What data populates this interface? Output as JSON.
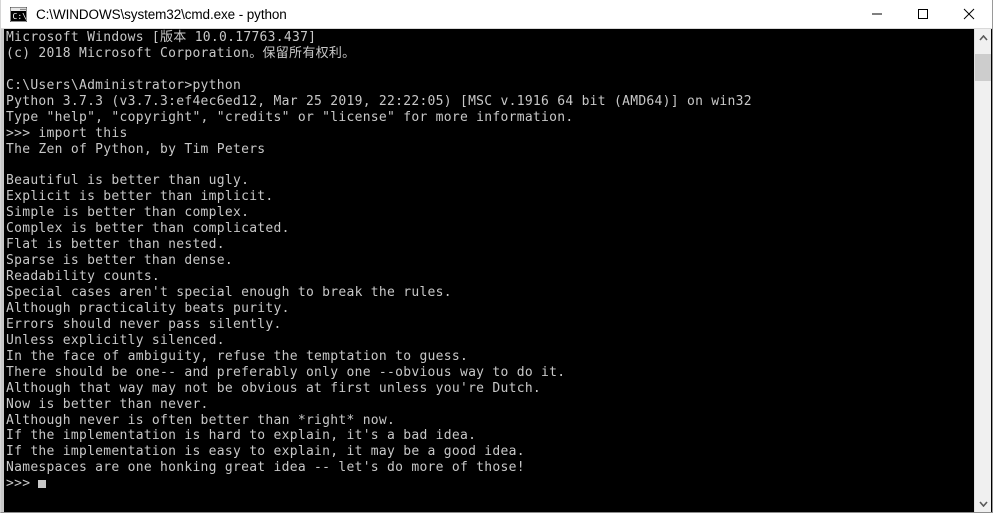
{
  "window": {
    "title": "C:\\WINDOWS\\system32\\cmd.exe - python",
    "icon": "cmd-console-icon",
    "background_color": "#000000",
    "titlebar_color": "#ffffff",
    "text_color": "#c8c8c8"
  },
  "controls": {
    "minimize_label": "Minimize",
    "maximize_label": "Maximize",
    "close_label": "Close"
  },
  "scrollbar": {
    "up_arrow_label": "Scroll up",
    "down_arrow_label": "Scroll down",
    "thumb_label": "Scroll thumb"
  },
  "console": {
    "lines": [
      "Microsoft Windows [版本 10.0.17763.437]",
      "(c) 2018 Microsoft Corporation。保留所有权利。",
      "",
      "C:\\Users\\Administrator>python",
      "Python 3.7.3 (v3.7.3:ef4ec6ed12, Mar 25 2019, 22:22:05) [MSC v.1916 64 bit (AMD64)] on win32",
      "Type \"help\", \"copyright\", \"credits\" or \"license\" for more information.",
      ">>> import this",
      "The Zen of Python, by Tim Peters",
      "",
      "Beautiful is better than ugly.",
      "Explicit is better than implicit.",
      "Simple is better than complex.",
      "Complex is better than complicated.",
      "Flat is better than nested.",
      "Sparse is better than dense.",
      "Readability counts.",
      "Special cases aren't special enough to break the rules.",
      "Although practicality beats purity.",
      "Errors should never pass silently.",
      "Unless explicitly silenced.",
      "In the face of ambiguity, refuse the temptation to guess.",
      "There should be one-- and preferably only one --obvious way to do it.",
      "Although that way may not be obvious at first unless you're Dutch.",
      "Now is better than never.",
      "Although never is often better than *right* now.",
      "If the implementation is hard to explain, it's a bad idea.",
      "If the implementation is easy to explain, it may be a good idea.",
      "Namespaces are one honking great idea -- let's do more of those!"
    ],
    "prompt": ">>> ",
    "cursor": "block-cursor"
  }
}
